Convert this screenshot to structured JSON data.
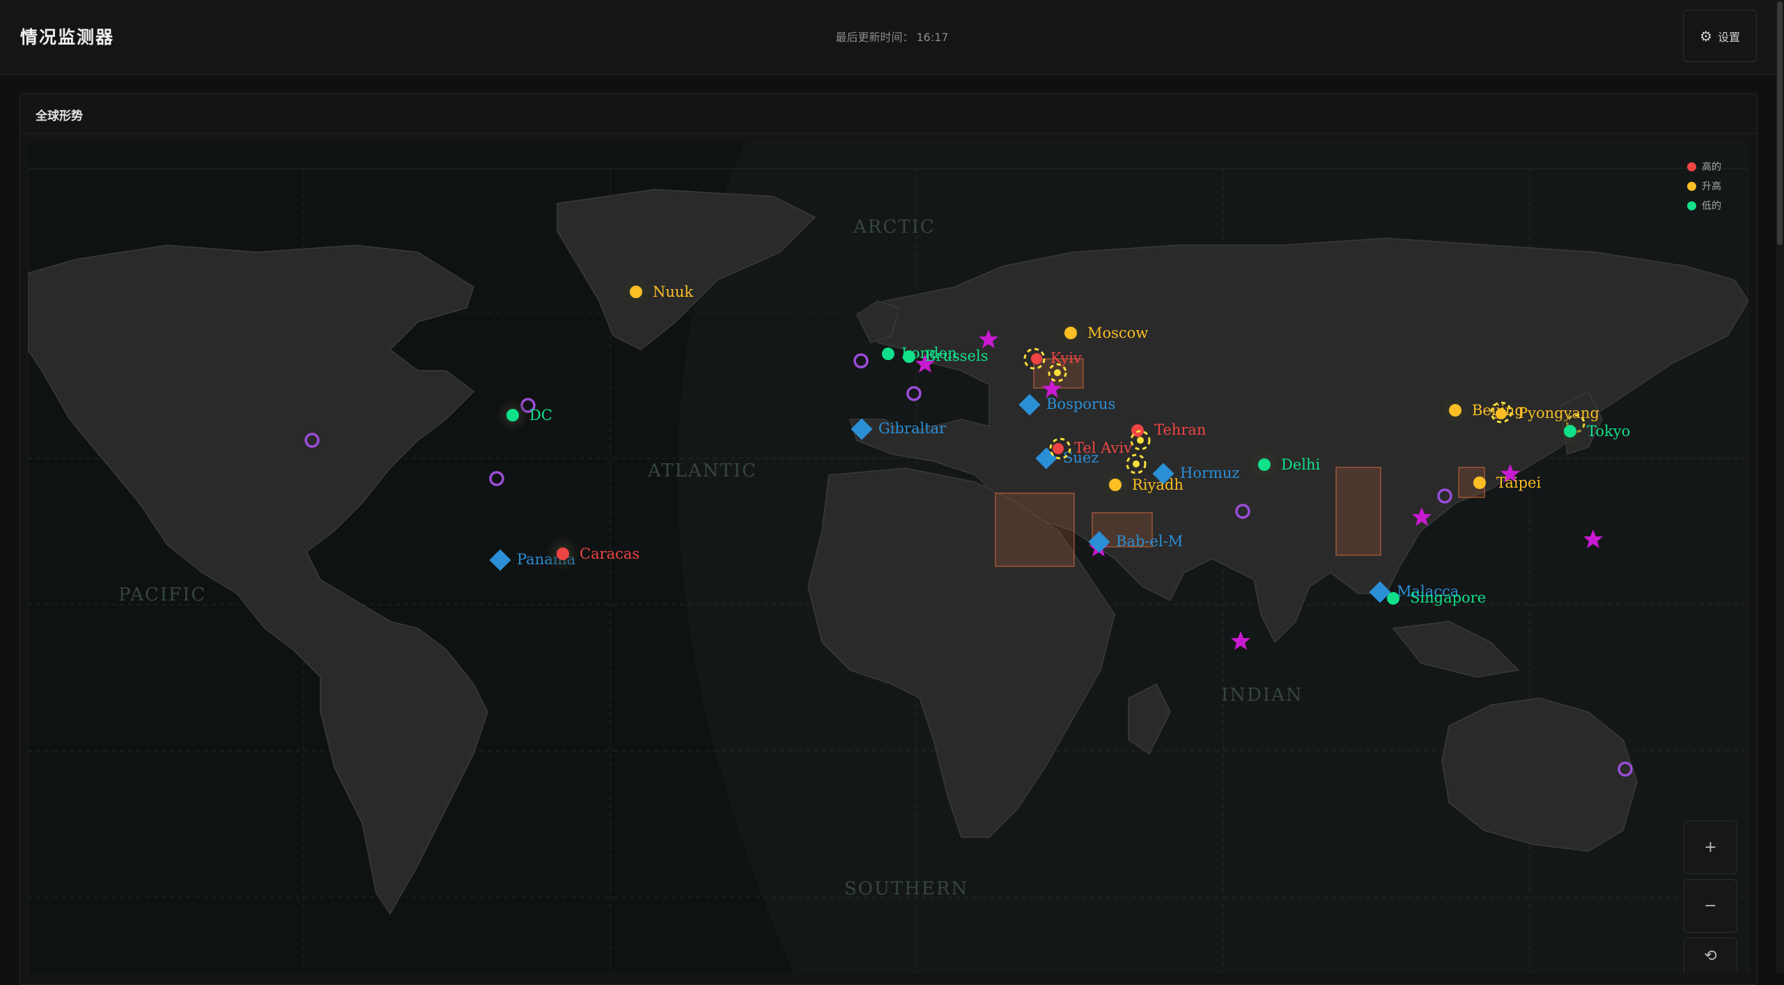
{
  "header": {
    "app_title": "情况监测器",
    "last_updated_label": "最后更新时间：",
    "last_updated_time": "16:17",
    "settings_label": "设置"
  },
  "panel": {
    "title": "全球形势"
  },
  "legend": [
    {
      "label": "高的",
      "color": "#ef4444"
    },
    {
      "label": "升高",
      "color": "#fbbf24"
    },
    {
      "label": "低的",
      "color": "#10e08a"
    }
  ],
  "map": {
    "regions": [
      "ARCTIC",
      "ATLANTIC",
      "PACIFIC",
      "INDIAN",
      "SOUTHERN"
    ],
    "hotspots": [
      {
        "name": "Nuuk",
        "level": "elevated"
      },
      {
        "name": "Moscow",
        "level": "elevated"
      },
      {
        "name": "London",
        "level": "low"
      },
      {
        "name": "Brussels",
        "level": "low"
      },
      {
        "name": "Kyiv",
        "level": "high"
      },
      {
        "name": "DC",
        "level": "low"
      },
      {
        "name": "Tehran",
        "level": "high"
      },
      {
        "name": "Tel Aviv",
        "level": "high"
      },
      {
        "name": "Riyadh",
        "level": "elevated"
      },
      {
        "name": "Delhi",
        "level": "low"
      },
      {
        "name": "Beijing",
        "level": "elevated"
      },
      {
        "name": "Pyongyang",
        "level": "elevated"
      },
      {
        "name": "Tokyo",
        "level": "low"
      },
      {
        "name": "Taipei",
        "level": "elevated"
      },
      {
        "name": "Caracas",
        "level": "high"
      },
      {
        "name": "Singapore",
        "level": "low"
      }
    ],
    "chokepoints": [
      "Gibraltar",
      "Bosporus",
      "Suez",
      "Hormuz",
      "Bab-el-M",
      "Panama",
      "Malacca"
    ]
  },
  "controls": {
    "zoom_in": "+",
    "zoom_out": "−"
  },
  "colors": {
    "high": "#ef4444",
    "elevated": "#fbbf24",
    "low": "#10e08a",
    "chokepoint": "#2b8fd6",
    "event": "#c81ad0",
    "base": "#9b4dd9",
    "conflict_zone": "#b5603a"
  }
}
